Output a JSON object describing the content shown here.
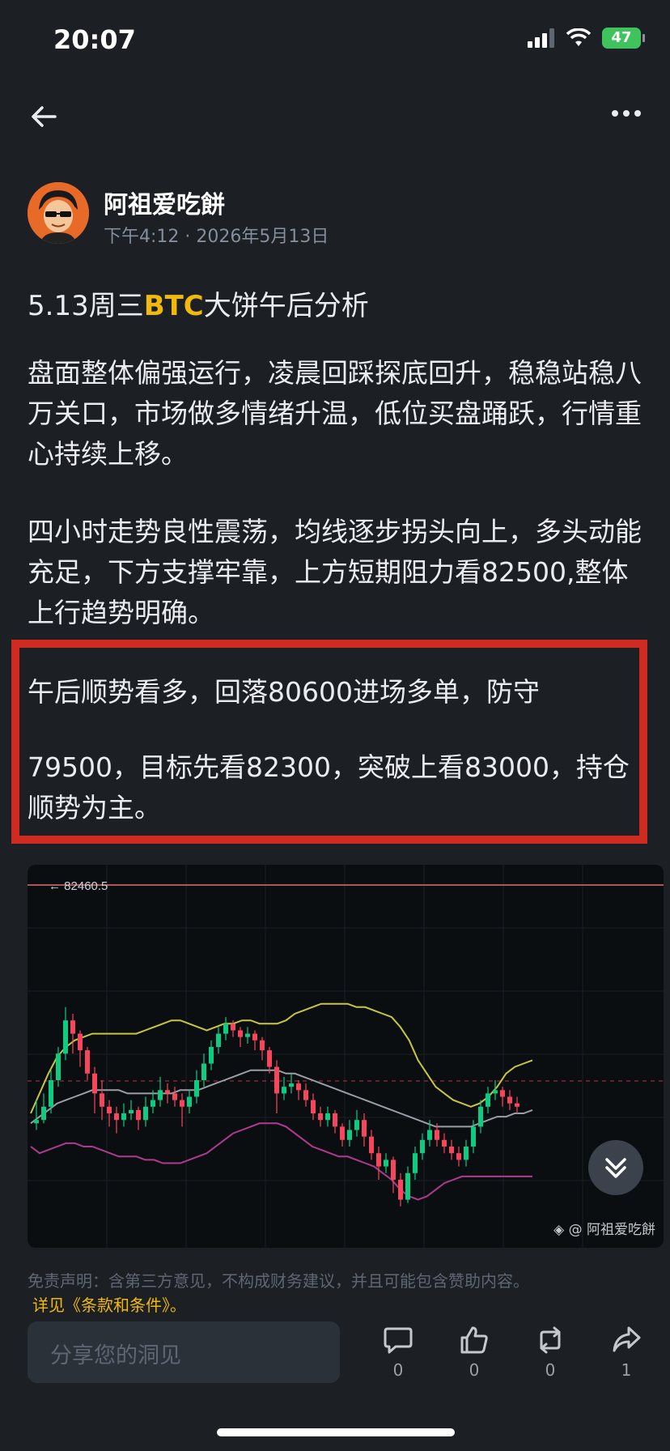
{
  "status_bar": {
    "time": "20:07",
    "battery": "47"
  },
  "post": {
    "author": "阿祖爱吃餅",
    "meta": "下午4:12 · 2026年5月13日",
    "title_prefix": "5.13周三",
    "title_coin": "BTC",
    "title_suffix": "大饼午后分析",
    "paragraph_1": "盘面整体偏强运行，凌晨回踩探底回升，稳稳站稳八万关口，市场做多情绪升温，低位买盘踊跃，行情重心持续上移。",
    "paragraph_2": "四小时走势良性震荡，均线逐步拐头向上，多头动能充足，下方支撑牢靠，上方短期阻力看82500,整体上行趋势明确。",
    "paragraph_3a": "午后顺势看多，回落80600进场多单，防守",
    "paragraph_3b": "79500，目标先看82300，突破上看83000，持仓顺势为主。"
  },
  "chart": {
    "price_label": "← 82460.5",
    "watermark": "@ 阿祖爱吃餅"
  },
  "chart_data": {
    "type": "candlestick",
    "title": "",
    "price_marker": 82460.5,
    "candles": [
      [
        57,
        58,
        64,
        55
      ],
      [
        58,
        62,
        66,
        57
      ],
      [
        62,
        70,
        73,
        60
      ],
      [
        70,
        78,
        80,
        68
      ],
      [
        78,
        88,
        92,
        76
      ],
      [
        88,
        84,
        90,
        78
      ],
      [
        84,
        79,
        85,
        74
      ],
      [
        79,
        72,
        80,
        70
      ],
      [
        72,
        66,
        74,
        60
      ],
      [
        66,
        62,
        70,
        58
      ],
      [
        62,
        60,
        64,
        56
      ],
      [
        60,
        58,
        62,
        54
      ],
      [
        58,
        60,
        63,
        56
      ],
      [
        60,
        61,
        64,
        58
      ],
      [
        61,
        58,
        62,
        55
      ],
      [
        58,
        62,
        65,
        56
      ],
      [
        62,
        64,
        67,
        60
      ],
      [
        64,
        67,
        71,
        62
      ],
      [
        67,
        66,
        69,
        63
      ],
      [
        66,
        64,
        68,
        62
      ],
      [
        64,
        62,
        66,
        56
      ],
      [
        62,
        65,
        67,
        60
      ],
      [
        65,
        70,
        73,
        63
      ],
      [
        70,
        75,
        78,
        68
      ],
      [
        75,
        80,
        82,
        73
      ],
      [
        80,
        84,
        86,
        78
      ],
      [
        84,
        87,
        89,
        82
      ],
      [
        87,
        85,
        88,
        83
      ],
      [
        85,
        83,
        86,
        80
      ],
      [
        83,
        84,
        86,
        81
      ],
      [
        84,
        82,
        85,
        79
      ],
      [
        82,
        79,
        83,
        76
      ],
      [
        79,
        74,
        80,
        72
      ],
      [
        74,
        66,
        76,
        60
      ],
      [
        66,
        68,
        71,
        64
      ],
      [
        68,
        69,
        72,
        66
      ],
      [
        69,
        67,
        70,
        64
      ],
      [
        67,
        64,
        69,
        62
      ],
      [
        64,
        60,
        66,
        58
      ],
      [
        60,
        58,
        62,
        56
      ],
      [
        58,
        60,
        62,
        56
      ],
      [
        60,
        56,
        61,
        54
      ],
      [
        56,
        52,
        57,
        50
      ],
      [
        52,
        55,
        58,
        50
      ],
      [
        55,
        58,
        61,
        53
      ],
      [
        58,
        53,
        60,
        50
      ],
      [
        53,
        48,
        55,
        46
      ],
      [
        48,
        44,
        50,
        40
      ],
      [
        44,
        46,
        48,
        42
      ],
      [
        46,
        40,
        47,
        36
      ],
      [
        40,
        34,
        42,
        32
      ],
      [
        34,
        42,
        44,
        33
      ],
      [
        42,
        48,
        50,
        40
      ],
      [
        48,
        52,
        54,
        46
      ],
      [
        52,
        55,
        58,
        50
      ],
      [
        55,
        52,
        57,
        50
      ],
      [
        52,
        50,
        54,
        48
      ],
      [
        50,
        48,
        52,
        46
      ],
      [
        48,
        46,
        50,
        44
      ],
      [
        46,
        50,
        52,
        44
      ],
      [
        50,
        56,
        58,
        48
      ],
      [
        56,
        62,
        64,
        54
      ],
      [
        62,
        66,
        68,
        60
      ],
      [
        66,
        67,
        70,
        64
      ],
      [
        67,
        65,
        68,
        62
      ],
      [
        65,
        63,
        67,
        61
      ],
      [
        63,
        62,
        65,
        60
      ]
    ],
    "upper_band": [
      60,
      66,
      72,
      77,
      80,
      82,
      83,
      84,
      84,
      84,
      84,
      84,
      84,
      85,
      86,
      87,
      88,
      88,
      87,
      86,
      85,
      86,
      87,
      87,
      88,
      88,
      87,
      87,
      87,
      88,
      90,
      91,
      92,
      93,
      93,
      93,
      93,
      92,
      92,
      91,
      90,
      89,
      86,
      82,
      76,
      72,
      68,
      66,
      64,
      63,
      62,
      63,
      65,
      68,
      72,
      74,
      75,
      76
    ],
    "middle_band": [
      57,
      59,
      61,
      63,
      64,
      65,
      66,
      67,
      67,
      67,
      67,
      66,
      66,
      66,
      66,
      66,
      66,
      67,
      67,
      67,
      68,
      69,
      70,
      71,
      72,
      73,
      73,
      73,
      73,
      72,
      72,
      71,
      70,
      69,
      68,
      67,
      66,
      65,
      64,
      63,
      62,
      61,
      60,
      59,
      58,
      57,
      56,
      56,
      56,
      56,
      56,
      57,
      58,
      59,
      59,
      60,
      60,
      61
    ],
    "lower_band": [
      50,
      48,
      49,
      50,
      51,
      51,
      50,
      50,
      49,
      48,
      47,
      47,
      47,
      46,
      46,
      45,
      45,
      45,
      46,
      47,
      48,
      50,
      52,
      54,
      55,
      56,
      57,
      57,
      57,
      56,
      54,
      52,
      50,
      49,
      48,
      47,
      47,
      46,
      45,
      44,
      42,
      40,
      37,
      35,
      34,
      35,
      37,
      39,
      40,
      41,
      41,
      41,
      41,
      41,
      41,
      41,
      41,
      41
    ]
  },
  "disclaimer": "免责声明：含第三方意见，不构成财务建议，并且可能包含赞助内容。",
  "terms_link": "详见《条款和条件》。",
  "input_placeholder": "分享您的洞见",
  "actions": {
    "comment": "0",
    "like": "0",
    "repost": "0",
    "share": "1"
  },
  "colors": {
    "accent": "#f0b90b",
    "up": "#0ecb81",
    "down": "#f6465d",
    "highlight": "#d02b21"
  }
}
